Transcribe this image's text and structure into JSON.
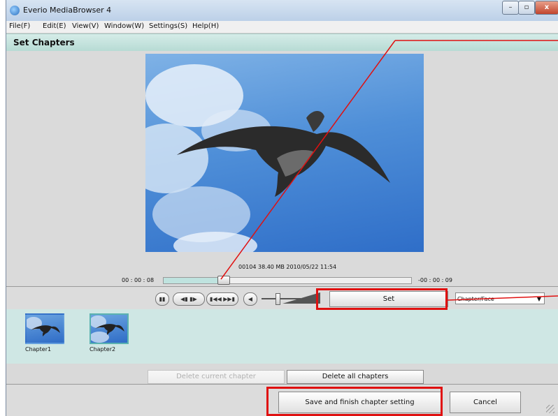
{
  "window": {
    "title": "Everio MediaBrowser 4",
    "minimize_symbol": "–",
    "maximize_symbol": "▫",
    "close_symbol": "x"
  },
  "menu": [
    {
      "label": "File(F)"
    },
    {
      "label": "Edit(E)"
    },
    {
      "label": "View(V)"
    },
    {
      "label": "Window(W)"
    },
    {
      "label": "Settings(S)"
    },
    {
      "label": "Help(H)"
    }
  ],
  "section": {
    "title": "Set Chapters"
  },
  "player": {
    "file_info": "00104 38.40 MB 2010/05/22 11:54",
    "time_elapsed": "00 : 00 : 08",
    "time_remaining": "-00 : 00 : 09",
    "seek_position_fraction": 0.24,
    "volume_fraction": 0.4
  },
  "controls": {
    "set_label": "Set",
    "mode_select_value": "Chapter/Face"
  },
  "chapters": [
    {
      "label": "Chapter1",
      "selected": false
    },
    {
      "label": "Chapter2",
      "selected": true
    }
  ],
  "actions": {
    "delete_current_label": "Delete current chapter",
    "delete_all_label": "Delete all chapters",
    "save_label": "Save and finish chapter setting",
    "cancel_label": "Cancel"
  },
  "colors": {
    "annotation_red": "#e01010",
    "section_teal": "#b7dbd4"
  }
}
